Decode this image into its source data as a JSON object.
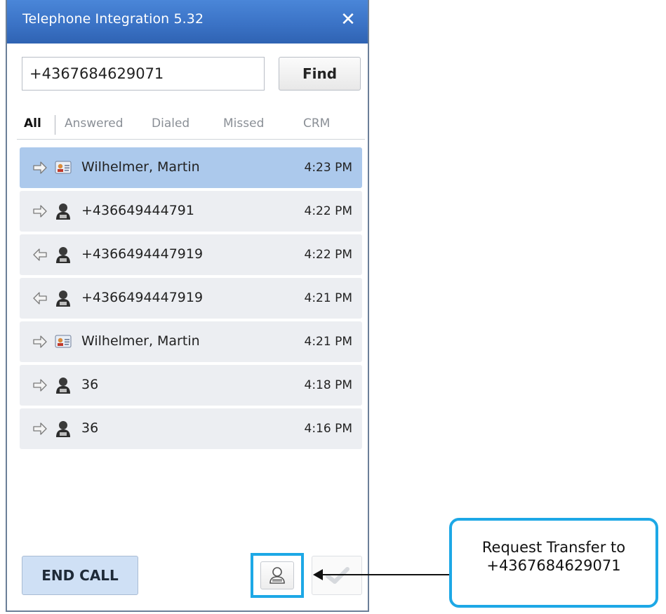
{
  "window": {
    "title": "Telephone Integration 5.32",
    "close_icon": "close-icon"
  },
  "search": {
    "value": "+4367684629071",
    "find_label": "Find"
  },
  "tabs": [
    {
      "label": "All",
      "active": true
    },
    {
      "label": "Answered",
      "active": false
    },
    {
      "label": "Dialed",
      "active": false
    },
    {
      "label": "Missed",
      "active": false
    },
    {
      "label": "CRM",
      "active": false
    }
  ],
  "calls": [
    {
      "direction": "outgoing",
      "contact_icon": "contact-card-icon",
      "name": "Wilhelmer, Martin",
      "time": "4:23 PM",
      "selected": true
    },
    {
      "direction": "outgoing",
      "contact_icon": "person-icon",
      "name": "+436649444791",
      "time": "4:22 PM",
      "selected": false
    },
    {
      "direction": "incoming",
      "contact_icon": "person-icon",
      "name": "+4366494447919",
      "time": "4:22 PM",
      "selected": false
    },
    {
      "direction": "incoming",
      "contact_icon": "person-icon",
      "name": "+4366494447919",
      "time": "4:21 PM",
      "selected": false
    },
    {
      "direction": "outgoing",
      "contact_icon": "contact-card-icon",
      "name": "Wilhelmer, Martin",
      "time": "4:21 PM",
      "selected": false
    },
    {
      "direction": "outgoing",
      "contact_icon": "person-icon",
      "name": "36",
      "time": "4:18 PM",
      "selected": false
    },
    {
      "direction": "outgoing",
      "contact_icon": "person-icon",
      "name": "36",
      "time": "4:16 PM",
      "selected": false
    }
  ],
  "footer": {
    "end_call_label": "END CALL",
    "transfer_icon": "person-transfer-icon",
    "confirm_icon": "check-icon"
  },
  "callout": {
    "line1": "Request Transfer to",
    "line2": "+4367684629071",
    "highlight_color": "#1da8e6"
  },
  "colors": {
    "titlebar": "#3b73c6",
    "selected_row": "#acc9ec",
    "row": "#eceef2",
    "end_call_bg": "#cfe0f5"
  }
}
